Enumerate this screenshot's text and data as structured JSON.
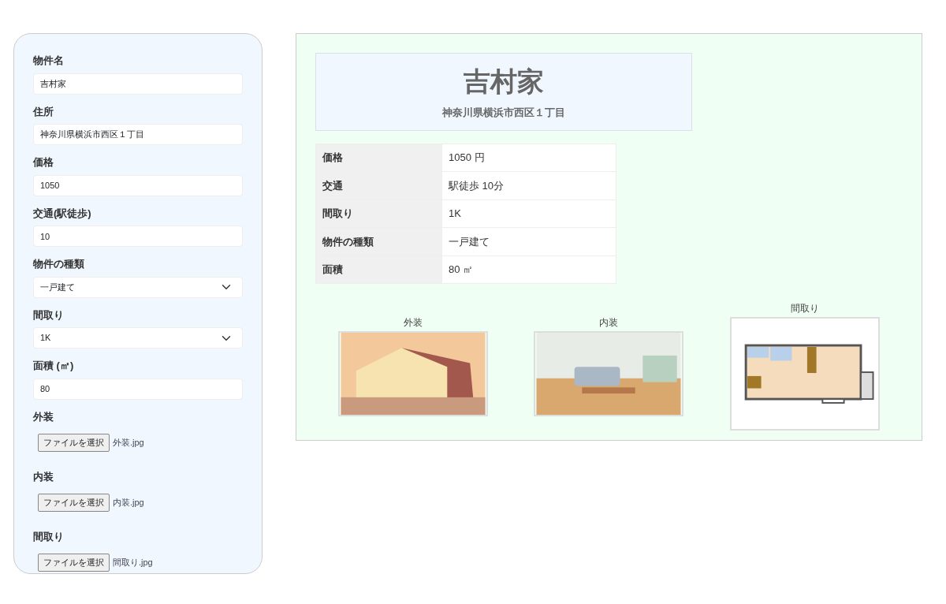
{
  "form": {
    "fields": [
      {
        "kind": "text",
        "label": "物件名",
        "value": "吉村家"
      },
      {
        "kind": "text",
        "label": "住所",
        "value": "神奈川県横浜市西区１丁目"
      },
      {
        "kind": "text",
        "label": "価格",
        "value": "1050"
      },
      {
        "kind": "text",
        "label": "交通(駅徒歩)",
        "value": "10"
      },
      {
        "kind": "select",
        "label": "物件の種類",
        "value": "一戸建て"
      },
      {
        "kind": "select",
        "label": "間取り",
        "value": "1K"
      },
      {
        "kind": "text",
        "label": "面積 (㎡)",
        "value": "80"
      },
      {
        "kind": "file",
        "label": "外装",
        "button": "ファイルを選択",
        "filename": "外装.jpg"
      },
      {
        "kind": "file",
        "label": "内装",
        "button": "ファイルを選択",
        "filename": "内装.jpg"
      },
      {
        "kind": "file",
        "label": "間取り",
        "button": "ファイルを選択",
        "filename": "間取り.jpg"
      }
    ]
  },
  "preview": {
    "title": "吉村家",
    "address": "神奈川県横浜市西区１丁目",
    "details": [
      {
        "label": "価格",
        "value": "1050 円"
      },
      {
        "label": "交通",
        "value": "駅徒歩 10分"
      },
      {
        "label": "間取り",
        "value": "1K"
      },
      {
        "label": "物件の種類",
        "value": "一戸建て"
      },
      {
        "label": "面積",
        "value": "80 ㎡"
      }
    ],
    "images": [
      {
        "kind": "exterior",
        "caption": "外装"
      },
      {
        "kind": "interior",
        "caption": "内装"
      },
      {
        "kind": "floorplan",
        "caption": "間取り"
      }
    ]
  }
}
